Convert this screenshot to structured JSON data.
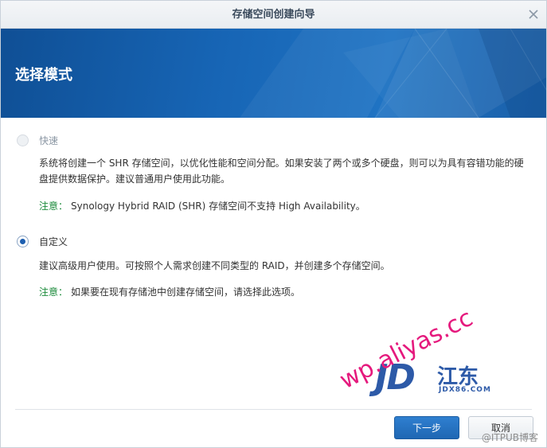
{
  "window": {
    "title": "存储空间创建向导",
    "close_icon": "close-icon"
  },
  "banner": {
    "heading": "选择模式"
  },
  "options": {
    "quick": {
      "label": "快速",
      "disabled": true,
      "selected": false,
      "description": "系统将创建一个 SHR 存储空间，以优化性能和空间分配。如果安装了两个或多个硬盘，则可以为具有容错功能的硬盘提供数据保护。建议普通用户使用此功能。",
      "note_label": "注意：",
      "note_text": "Synology Hybrid RAID (SHR) 存储空间不支持 High Availability。"
    },
    "custom": {
      "label": "自定义",
      "disabled": false,
      "selected": true,
      "description": "建议高级用户使用。可按照个人需求创建不同类型的 RAID，并创建多个存储空间。",
      "note_label": "注意：",
      "note_text": "如果要在现有存储池中创建存储空间，请选择此选项。"
    }
  },
  "footer": {
    "next_label": "下一步",
    "cancel_label": "取消"
  },
  "watermarks": {
    "jd_logo": "JD",
    "jd_cn": "江东",
    "jd_domain": "JDX86.COM",
    "wp_text": "wp.aliyas.cc",
    "itpub": "@ITPUB博客"
  },
  "colors": {
    "banner": "#1765b5",
    "accent_button": "#1f67b3",
    "note_green": "#1a8a3a",
    "watermark_pink": "#e5197d",
    "watermark_blue": "#2d5aa8"
  }
}
